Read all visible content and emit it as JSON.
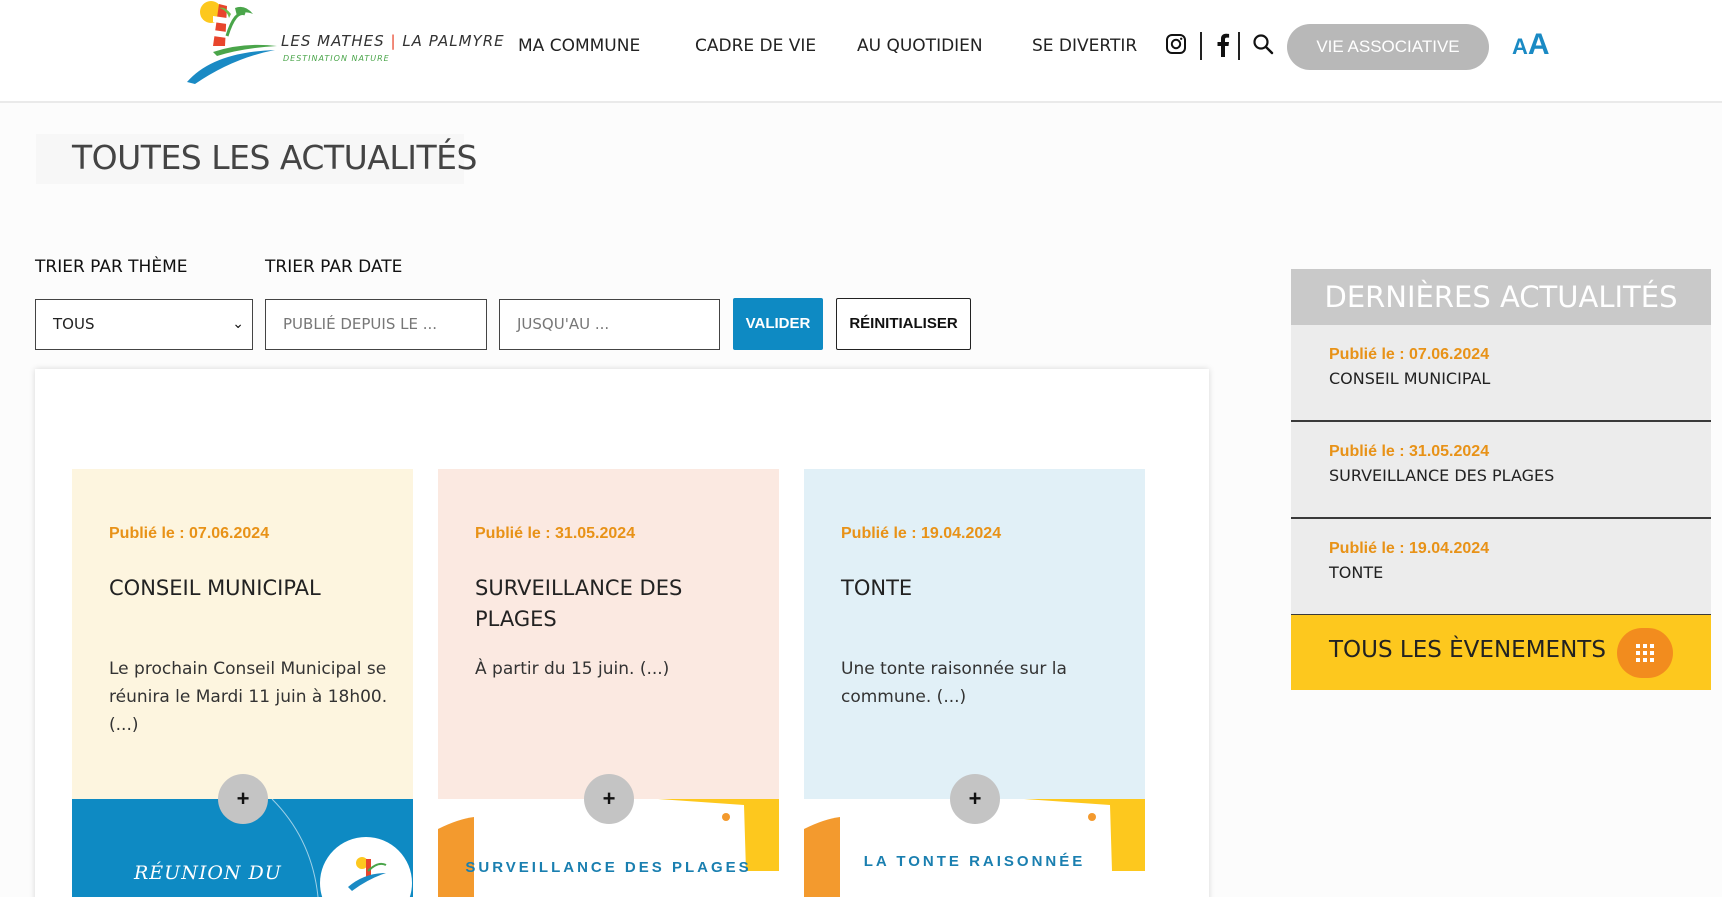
{
  "header": {
    "logo_main": "LES MATHES",
    "logo_sep": "|",
    "logo_second": "LA PALMYRE",
    "logo_tagline": "DESTINATION NATURE",
    "nav": [
      "MA COMMUNE",
      "CADRE DE VIE",
      "AU QUOTIDIEN",
      "SE DIVERTIR"
    ],
    "social_icons": [
      "instagram-icon",
      "facebook-icon",
      "search-icon"
    ],
    "vie_associative": "VIE ASSOCIATIVE",
    "font_size_small": "A",
    "font_size_big": "A"
  },
  "page": {
    "title": "TOUTES LES ACTUALITÉS"
  },
  "filters": {
    "theme_label": "TRIER PAR THÈME",
    "date_label": "TRIER PAR DATE",
    "theme_value": "TOUS",
    "date_from_placeholder": "PUBLIÉ DEPUIS LE ...",
    "date_to_placeholder": "JUSQU'AU ...",
    "validate_label": "VALIDER",
    "reset_label": "RÉINITIALISER"
  },
  "cards": [
    {
      "date": "Publié le : 07.06.2024",
      "title": "CONSEIL MUNICIPAL",
      "excerpt": "Le prochain Conseil Municipal se réunira le Mardi 11 juin à 18h00. (...)",
      "bg_color": "#fdf5df",
      "image_text": "RÉUNION DU",
      "plus": "+"
    },
    {
      "date": "Publié le : 31.05.2024",
      "title": "SURVEILLANCE DES PLAGES",
      "excerpt": "À partir du 15 juin. (...)",
      "bg_color": "#fbe9e1",
      "image_text": "SURVEILLANCE DES PLAGES",
      "plus": "+"
    },
    {
      "date": "Publié le : 19.04.2024",
      "title": "TONTE",
      "excerpt": "Une tonte raisonnée sur la commune. (...)",
      "bg_color": "#e1f0f7",
      "image_text": "LA TONTE RAISONNÉE",
      "plus": "+"
    }
  ],
  "sidebar": {
    "heading": "DERNIÈRES ACTUALITÉS",
    "items": [
      {
        "date": "Publié le : 07.06.2024",
        "title": "CONSEIL MUNICIPAL"
      },
      {
        "date": "Publié le : 31.05.2024",
        "title": "SURVEILLANCE DES PLAGES"
      },
      {
        "date": "Publié le : 19.04.2024",
        "title": "TONTE"
      }
    ],
    "events_label": "TOUS LES ÈVENEMENTS",
    "events_icon": "grid-icon"
  },
  "colors": {
    "accent_blue": "#0e8ac3",
    "date_orange": "#e89217",
    "events_yellow": "#fdc81e",
    "events_orange": "#f28c1e"
  }
}
